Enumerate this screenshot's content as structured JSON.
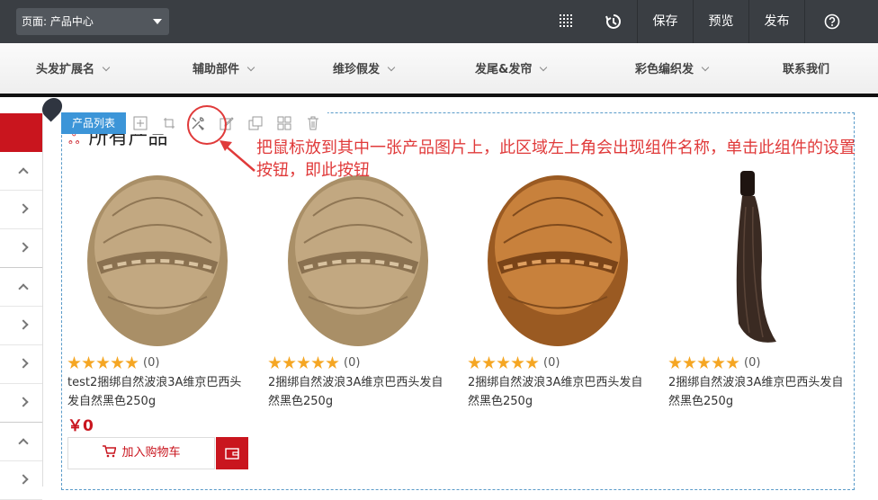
{
  "topbar": {
    "page_label": "页面: 产品中心",
    "save_label": "保存",
    "preview_label": "预览",
    "publish_label": "发布",
    "help_icon": "question-circle-icon"
  },
  "nav": {
    "items": [
      {
        "label": "头发扩展名"
      },
      {
        "label": "辅助部件"
      },
      {
        "label": "维珍假发"
      },
      {
        "label": "发尾&发帘"
      },
      {
        "label": "彩色编织发"
      },
      {
        "label": "联系我们"
      }
    ]
  },
  "module": {
    "tag_label": "产品列表",
    "title": "所有产品",
    "tools": [
      "add-icon",
      "move-icon",
      "settings-icon",
      "edit-icon",
      "copy-icon",
      "grid-icon",
      "delete-icon"
    ]
  },
  "products": [
    {
      "name": "test2捆绑自然波浪3A维京巴西头发自然黑色250g",
      "rating_count": "(0)",
      "price": "￥0",
      "image": "braided-bun-blonde"
    },
    {
      "name": "2捆绑自然波浪3A维京巴西头发自然黑色250g",
      "rating_count": "(0)",
      "image": "braided-bun-blonde"
    },
    {
      "name": "2捆绑自然波浪3A维京巴西头发自然黑色250g",
      "rating_count": "(0)",
      "image": "braided-bun-auburn"
    },
    {
      "name": "2捆绑自然波浪3A维京巴西头发自然黑色250g",
      "rating_count": "(0)",
      "image": "ponytail-dark"
    }
  ],
  "cart": {
    "label": "加入购物车"
  },
  "annotation": {
    "text": "把鼠标放到其中一张产品图片上，此区域左上角会出现组件名称，单击此组件的设置按钮，即此按钮"
  },
  "colors": {
    "brand_red": "#c9151e",
    "toolbar_dark": "#3a3e43",
    "module_blue": "#3c95d8",
    "annotation_red": "#e03a3a"
  }
}
